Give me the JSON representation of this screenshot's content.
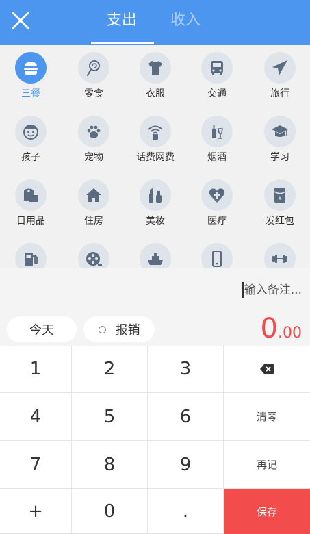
{
  "header": {
    "close_icon": "close-icon",
    "tabs": [
      {
        "label": "支出",
        "active": true
      },
      {
        "label": "收入",
        "active": false
      }
    ],
    "background_color": "#4c96f0"
  },
  "categories": [
    {
      "label": "三餐",
      "icon": "burger-icon",
      "active": true
    },
    {
      "label": "零食",
      "icon": "lollipop-icon",
      "active": false
    },
    {
      "label": "衣服",
      "icon": "tshirt-icon",
      "active": false
    },
    {
      "label": "交通",
      "icon": "bus-icon",
      "active": false
    },
    {
      "label": "旅行",
      "icon": "airplane-icon",
      "active": false
    },
    {
      "label": "孩子",
      "icon": "child-face-icon",
      "active": false
    },
    {
      "label": "宠物",
      "icon": "paw-icon",
      "active": false
    },
    {
      "label": "话费网费",
      "icon": "wifi-phone-icon",
      "active": false
    },
    {
      "label": "烟酒",
      "icon": "bottle-icon",
      "active": false
    },
    {
      "label": "学习",
      "icon": "graduation-cap-icon",
      "active": false
    },
    {
      "label": "日用品",
      "icon": "toilet-roll-icon",
      "active": false
    },
    {
      "label": "住房",
      "icon": "house-icon",
      "active": false
    },
    {
      "label": "美妆",
      "icon": "cosmetics-icon",
      "active": false
    },
    {
      "label": "医疗",
      "icon": "heart-cross-icon",
      "active": false
    },
    {
      "label": "发红包",
      "icon": "red-envelope-icon",
      "active": false
    },
    {
      "label": "",
      "icon": "gas-pump-icon",
      "active": false
    },
    {
      "label": "",
      "icon": "film-reel-icon",
      "active": false
    },
    {
      "label": "",
      "icon": "ship-icon",
      "active": false
    },
    {
      "label": "",
      "icon": "mobile-phone-icon",
      "active": false
    },
    {
      "label": "",
      "icon": "dumbbell-icon",
      "active": false
    }
  ],
  "note": {
    "placeholder": "输入备注..."
  },
  "controls": {
    "date_label": "今天",
    "reimburse_label": "报销",
    "amount_integer": "0",
    "amount_decimal": ".00",
    "amount_color": "#f24c4c"
  },
  "keypad": {
    "keys": [
      "1",
      "2",
      "3",
      "4",
      "5",
      "6",
      "7",
      "8",
      "9",
      "+",
      "0",
      "."
    ],
    "backspace_icon": "backspace-icon",
    "clear_label": "清零",
    "again_label": "再记",
    "save_label": "保存",
    "save_color": "#f24c4c"
  }
}
